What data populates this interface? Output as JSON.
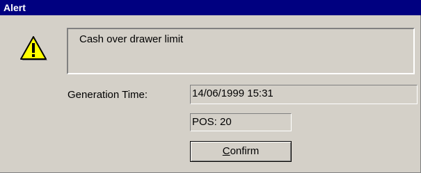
{
  "window": {
    "title": "Alert"
  },
  "alert": {
    "icon": "warning-icon",
    "message": "Cash over drawer limit"
  },
  "details": {
    "generation_time_label": "Generation Time:",
    "generation_time_value": "14/06/1999 15:31",
    "pos_value": "POS: 20"
  },
  "actions": {
    "confirm_mnemonic": "C",
    "confirm_rest": "onfirm"
  },
  "colors": {
    "titlebar": "#000080",
    "face": "#d4d0c8",
    "warning_fill": "#ffff00"
  }
}
